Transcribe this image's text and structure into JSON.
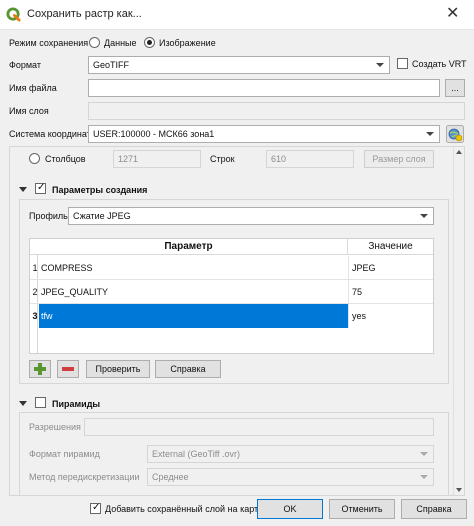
{
  "window": {
    "title": "Сохранить растр как...",
    "close_glyph": "✕"
  },
  "mode": {
    "label": "Режим сохранения",
    "opt_data": "Данные",
    "opt_image": "Изображение",
    "selected": "image"
  },
  "format": {
    "label": "Формат",
    "value": "GeoTIFF",
    "vrt_label": "Создать VRT"
  },
  "filename": {
    "label": "Имя файла",
    "value": "",
    "browse": "..."
  },
  "layername": {
    "label": "Имя слоя",
    "value": ""
  },
  "crs": {
    "label": "Система координат",
    "value": "USER:100000 - МСК66 зона1"
  },
  "resolution": {
    "cols_label": "Столбцов",
    "cols_value": "1271",
    "rows_label": "Строк",
    "rows_value": "610",
    "layer_size_button": "Размер слоя"
  },
  "creation": {
    "title": "Параметры создания",
    "profile_label": "Профиль",
    "profile_value": "Сжатие JPEG",
    "table": {
      "headers": {
        "param": "Параметр",
        "value": "Значение"
      },
      "rows": [
        {
          "num": "1",
          "param": "COMPRESS",
          "value": "JPEG",
          "selected": false
        },
        {
          "num": "2",
          "param": "JPEG_QUALITY",
          "value": "75",
          "selected": false
        },
        {
          "num": "3",
          "param": "tfw",
          "value": "yes",
          "selected": true
        }
      ]
    },
    "validate_button": "Проверить",
    "help_button": "Справка"
  },
  "pyramids": {
    "title": "Пирамиды",
    "resolutions_label": "Разрешения",
    "format_label": "Формат пирамид",
    "format_value": "External (GeoTiff .ovr)",
    "resample_label": "Метод передискретизации",
    "resample_value": "Среднее"
  },
  "footer": {
    "add_layer_label": "Добавить сохранённый слой на карту",
    "ok": "OK",
    "cancel": "Отменить",
    "help": "Справка"
  },
  "colors": {
    "selection": "#0078d7",
    "qgis_green": "#589632",
    "remove_red": "#d23c3c"
  }
}
